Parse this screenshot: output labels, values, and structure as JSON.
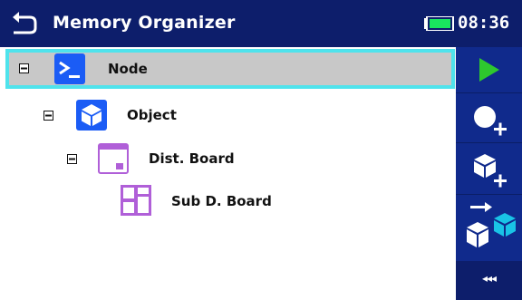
{
  "header": {
    "title": "Memory Organizer",
    "time": "08:36",
    "back_icon": "back-arrow-icon",
    "battery_icon": "battery-icon"
  },
  "tree": {
    "items": [
      {
        "label": "Node",
        "icon": "node-terminal-icon",
        "expanded": true,
        "selected": true
      },
      {
        "label": "Object",
        "icon": "object-cube-icon",
        "expanded": true
      },
      {
        "label": "Dist. Board",
        "icon": "dist-board-icon",
        "expanded": true
      },
      {
        "label": "Sub D. Board",
        "icon": "sub-board-icon"
      }
    ]
  },
  "sidebar": {
    "buttons": [
      {
        "icon": "play-icon"
      },
      {
        "icon": "add-measurement-icon"
      },
      {
        "icon": "add-object-icon"
      },
      {
        "icon": "copy-structure-icon"
      }
    ],
    "more_label": "◂◂◂"
  },
  "colors": {
    "header_bg": "#0d1e6b",
    "sidebar_bg": "#102a8c",
    "selection_border": "#4fe3ec",
    "selection_bg": "#c8c8c8",
    "play_green": "#2ec82e"
  }
}
